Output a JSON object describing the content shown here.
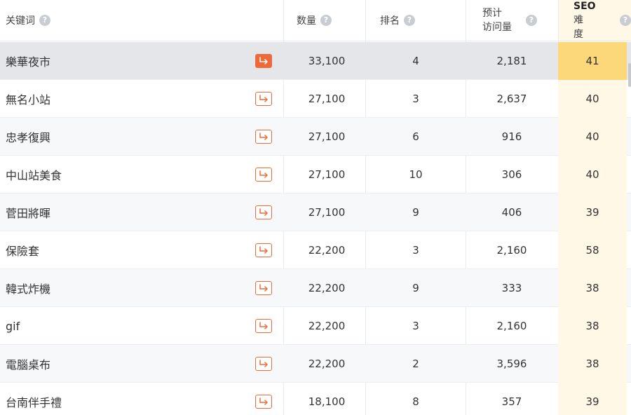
{
  "header": {
    "keyword": "关键词",
    "volume": "数量",
    "rank": "排名",
    "visits_line1": "预计",
    "visits_line2": "访问量",
    "seo_strong": "SEO",
    "seo_rest1": "难",
    "seo_rest2": "度",
    "help_glyph": "?"
  },
  "rows": [
    {
      "keyword": "樂華夜市",
      "volume": "33,100",
      "rank": "4",
      "visits": "2,181",
      "seo": "41"
    },
    {
      "keyword": "無名小站",
      "volume": "27,100",
      "rank": "3",
      "visits": "2,637",
      "seo": "40"
    },
    {
      "keyword": "忠孝復興",
      "volume": "27,100",
      "rank": "6",
      "visits": "916",
      "seo": "40"
    },
    {
      "keyword": "中山站美食",
      "volume": "27,100",
      "rank": "10",
      "visits": "306",
      "seo": "40"
    },
    {
      "keyword": "菅田將暉",
      "volume": "27,100",
      "rank": "9",
      "visits": "406",
      "seo": "39"
    },
    {
      "keyword": "保險套",
      "volume": "22,200",
      "rank": "3",
      "visits": "2,160",
      "seo": "58"
    },
    {
      "keyword": "韓式炸機",
      "volume": "22,200",
      "rank": "9",
      "visits": "333",
      "seo": "38"
    },
    {
      "keyword": "gif",
      "volume": "22,200",
      "rank": "3",
      "visits": "2,160",
      "seo": "38"
    },
    {
      "keyword": "電腦桌布",
      "volume": "22,200",
      "rank": "2",
      "visits": "3,596",
      "seo": "38"
    },
    {
      "keyword": "台南伴手禮",
      "volume": "18,100",
      "rank": "8",
      "visits": "357",
      "seo": "39"
    }
  ],
  "colors": {
    "accent": "#ef6a3a",
    "seo_column_bg": "#fff8e6",
    "seo_highlight": "#fdd87a",
    "active_row_bg": "#e4e6ea"
  },
  "icons": {
    "go": "arrow-turn-right-icon",
    "help": "question-circle-icon"
  }
}
